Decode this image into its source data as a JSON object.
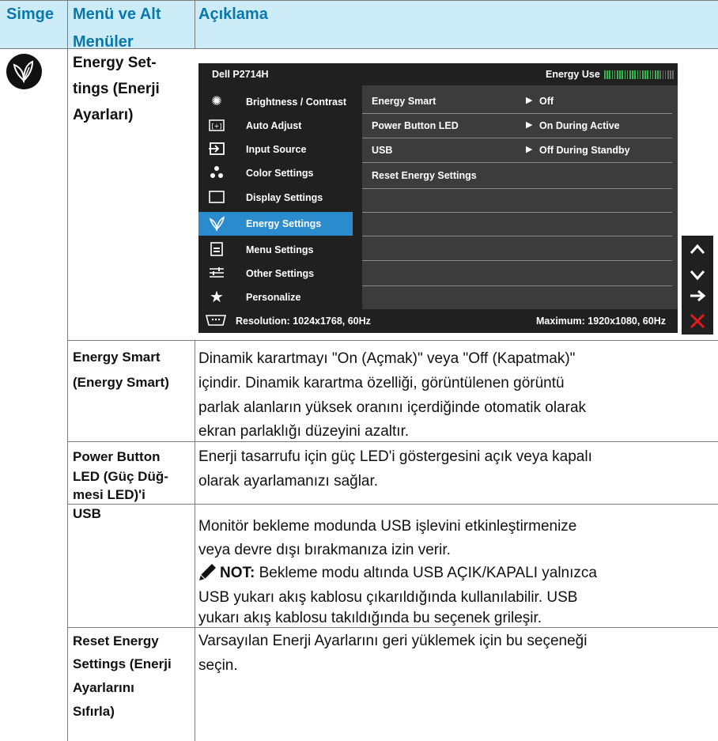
{
  "header": {
    "col_icon": "Simge",
    "col_menu_line1": "Menü ve Alt",
    "col_menu_line2": "Menüler",
    "col_desc": "Açıklama"
  },
  "energy_row": {
    "title_line1": "Energy Set-",
    "title_line2": "tings (Enerji",
    "title_line3": "Ayarları)"
  },
  "osd": {
    "model": "Dell P2714H",
    "energy_use_label": "Energy Use",
    "energy_use_level": 0.8,
    "menu_items": [
      {
        "label": "Brightness / Contrast",
        "icon": "brightness-icon"
      },
      {
        "label": "Auto Adjust",
        "icon": "auto-adjust-icon"
      },
      {
        "label": "Input Source",
        "icon": "input-source-icon"
      },
      {
        "label": "Color Settings",
        "icon": "color-settings-icon"
      },
      {
        "label": "Display Settings",
        "icon": "display-settings-icon"
      },
      {
        "label": "Energy Settings",
        "icon": "energy-leaf-icon",
        "selected": true
      },
      {
        "label": "Menu Settings",
        "icon": "menu-settings-icon"
      },
      {
        "label": "Other Settings",
        "icon": "other-settings-icon"
      },
      {
        "label": "Personalize",
        "icon": "star-icon"
      }
    ],
    "options": [
      {
        "label": "Energy Smart",
        "value": "Off"
      },
      {
        "label": "Power Button LED",
        "value": "On During Active"
      },
      {
        "label": "USB",
        "value": "Off During Standby"
      },
      {
        "label": "Reset Energy Settings",
        "value": ""
      }
    ],
    "resolution": "Resolution: 1024x1768, 60Hz",
    "maximum": "Maximum: 1920x1080, 60Hz",
    "side_buttons": [
      "up-arrow-icon",
      "down-arrow-icon",
      "right-arrow-icon",
      "close-icon"
    ],
    "colors": {
      "osd_bg": "#202020",
      "selected": "#2b8ccd",
      "close": "#e01b1b",
      "header_text": "#0b78ad",
      "header_band": "#ccecf7"
    }
  },
  "rows": [
    {
      "sub_line1": "Energy Smart",
      "sub_line2": "(Energy Smart)",
      "desc_lines": [
        "Dinamik karartmayı \"On (Açmak)\" veya \"Off (Kapatmak)\"",
        "içindir. Dinamik karartma özelliği, görüntülenen görüntü",
        "parlak alanların yüksek oranını içerdiğinde otomatik olarak",
        "ekran parlaklığı düzeyini azaltır."
      ]
    },
    {
      "sub_line1": "Power Button",
      "sub_line2": "LED (Güç Düğ-",
      "sub_line3": "mesi LED)'i",
      "desc_lines": [
        "Enerji tasarrufu için güç LED'i göstergesini açık veya kapalı",
        "olarak ayarlamanızı sağlar."
      ]
    },
    {
      "sub_line1": "USB",
      "desc_lines": [
        "Monitör bekleme modunda USB işlevini etkinleştirmenize",
        "veya devre dışı bırakmanıza izin verir."
      ],
      "note_label": "NOT:",
      "note_first": " Bekleme modu altında USB AÇIK/KAPALI yalnızca",
      "note_lines": [
        "USB yukarı akış kablosu çıkarıldığında kullanılabilir. USB",
        "yukarı akış kablosu takıldığında bu seçenek grileşir."
      ]
    },
    {
      "sub_line1": "Reset Energy",
      "sub_line2": "Settings (Enerji",
      "sub_line3": "Ayarlarını",
      "sub_line4": "Sıfırla)",
      "desc_lines": [
        "Varsayılan Enerji Ayarlarını geri yüklemek için bu seçeneği",
        "seçin."
      ]
    }
  ]
}
